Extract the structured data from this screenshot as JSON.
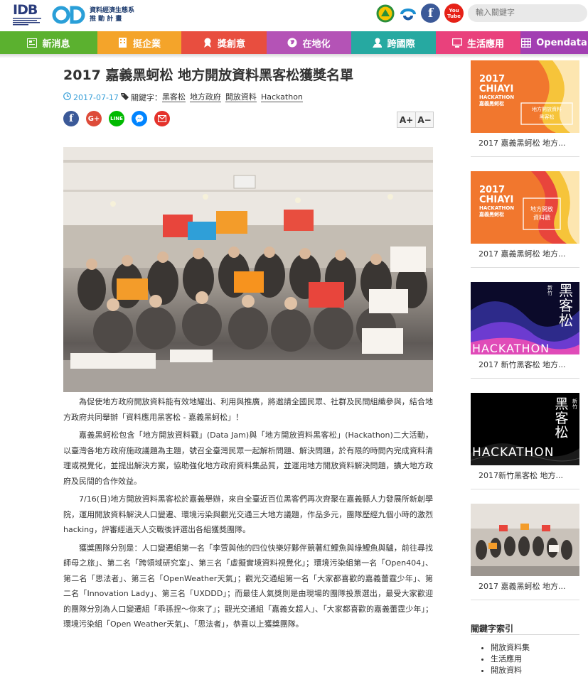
{
  "header": {
    "idb_logo": "IDB",
    "od_logo": "OD",
    "od_org_line1": "資料經濟生態系",
    "od_org_line2": "推 動 計 畫",
    "search_placeholder": "輸入關鍵字",
    "youtube_label": "You Tube"
  },
  "nav": [
    {
      "label": "新消息",
      "color": "#5bb12f",
      "icon": "news-icon"
    },
    {
      "label": "挺企業",
      "color": "#f4a42a",
      "icon": "building-icon"
    },
    {
      "label": "獎創意",
      "color": "#e84e3f",
      "icon": "ribbon-icon"
    },
    {
      "label": "在地化",
      "color": "#b453b6",
      "icon": "globe-icon"
    },
    {
      "label": "跨國際",
      "color": "#26a9a1",
      "icon": "map-icon"
    },
    {
      "label": "生活應用",
      "color": "#e9417c",
      "icon": "monitor-icon"
    },
    {
      "label": "Opendata",
      "color": "#a23fb2",
      "icon": "grid-icon"
    }
  ],
  "article": {
    "title": "2017 嘉義黑蚵松 地方開放資料黑客松獲獎名單",
    "date": "2017-07-17",
    "keywords_label": "關鍵字：",
    "keywords": [
      "黑客松",
      "地方政府",
      "開放資料",
      "Hackathon"
    ],
    "font_larger": "A+",
    "font_smaller": "A−",
    "paragraphs": [
      "為促使地方政府開放資料能有效地耀出、利用與推廣，將邀請全國民眾、社群及民間組織參與，結合地方政府共同舉辦「資料應用黑客松 - 嘉義黑蚵松」！",
      "嘉義黑蚵松包含「地方開放資料戳」(Data Jam)與「地方開放資料黑客松」(Hackathon)二大活動，以臺灣各地方政府施政議題為主題，號召全臺灣民眾一起解析問題、解決問題，於有限的時間內完成資料清理或視覺化，並提出解決方案，協助強化地方政府資料集品質，並運用地方開放資料解決問題，擴大地方政府及民間的合作效益。",
      "7/16(日)地方開放資料黑客松於嘉義舉辦，來自全臺近百位黑客們再次齊聚在嘉義縣人力發展所新創學院，運用開放資料解決人口變遷、環境污染與觀光交通三大地方議題，作品多元，團隊歷經九個小時的激烈hacking，評審經過天人交戰後評選出各組獲獎團隊。",
      "獲獎團隊分別是：人口變遷組第一名「李萱與他的四位快樂好夥伴競著紅鯉魚與綠鯉魚與驢，前往尋找師母之旅」、第二名「跨領域研究室」、第三名「虛擬實境資料視覺化」；環境污染組第一名「Open404」、第二名「思法者」、第三名「OpenWeather天氣」；觀光交通組第一名「大家都喜歡的嘉義蕾霆少年」、第二名「Innovation Lady」、第三名「UXDDD」；而最佳人氣獎則是由現場的團隊投票選出，最受大家歡迎的團隊分別為人口變遷組「乖孫捏～你來了」；觀光交通組「嘉義女超人」、「大家都喜歡的嘉義蕾霆少年」；環境污染組「Open Weather天氣」、「思法者」，恭喜以上獲獎團隊。"
    ]
  },
  "sidebar": {
    "cards": [
      {
        "caption": "2017 嘉義黑蚵松 地方...",
        "poster_year": "2017",
        "poster_city": "CHIAYI",
        "poster_event": "HACKATHON",
        "poster_sub": "嘉義黑蚵松",
        "poster_box_1": "地方開放資料",
        "poster_box_2": "黑客松"
      },
      {
        "caption": "2017 嘉義黑蚵松 地方...",
        "poster_year": "2017",
        "poster_city": "CHIAYI",
        "poster_event": "HACKATHON",
        "poster_sub": "嘉義黑蚵松",
        "poster_box_1": "地方開放",
        "poster_box_2": "資料戳"
      },
      {
        "caption": "2017 新竹黑客松 地方...",
        "poster_big": "黑客松",
        "poster_small": "新竹",
        "poster_word": "HACKATHON"
      },
      {
        "caption": "2017新竹黑客松 地方...",
        "poster_big": "黑客松",
        "poster_small": "新竹",
        "poster_word": "HACKATHON"
      },
      {
        "caption": "2017 嘉義黑蚵松 地方..."
      }
    ],
    "keyword_index_title": "關鍵字索引",
    "keyword_index": [
      "開放資料集",
      "生活應用",
      "開放資料"
    ]
  },
  "colors": {
    "facebook": "#3b5998",
    "google": "#dd4b39",
    "line": "#00b900",
    "messenger": "#0084ff",
    "mail": "#e4322b",
    "youtube": "#e62117",
    "date": "#3aa0d8",
    "poster_orange": "#f1772e"
  }
}
